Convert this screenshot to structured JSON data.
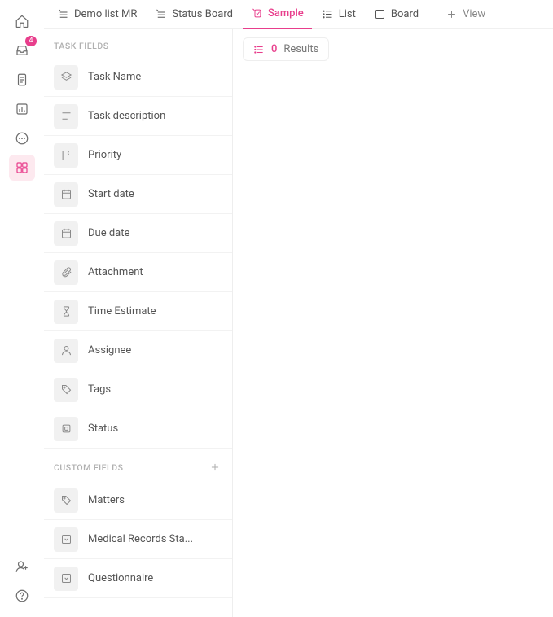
{
  "rail": {
    "inbox_badge": "4"
  },
  "tabs": [
    {
      "label": "Demo list MR",
      "icon": "list-pin"
    },
    {
      "label": "Status Board",
      "icon": "list-pin"
    },
    {
      "label": "Sample",
      "icon": "doc-pin",
      "active": true
    },
    {
      "label": "List",
      "icon": "list"
    },
    {
      "label": "Board",
      "icon": "board"
    }
  ],
  "addView": {
    "label": "View"
  },
  "sections": {
    "task_fields_header": "TASK FIELDS",
    "custom_fields_header": "CUSTOM FIELDS"
  },
  "task_fields": [
    {
      "label": "Task Name",
      "icon": "layers"
    },
    {
      "label": "Task description",
      "icon": "text"
    },
    {
      "label": "Priority",
      "icon": "flag"
    },
    {
      "label": "Start date",
      "icon": "calendar"
    },
    {
      "label": "Due date",
      "icon": "calendar"
    },
    {
      "label": "Attachment",
      "icon": "paperclip"
    },
    {
      "label": "Time Estimate",
      "icon": "hourglass"
    },
    {
      "label": "Assignee",
      "icon": "user"
    },
    {
      "label": "Tags",
      "icon": "tag"
    },
    {
      "label": "Status",
      "icon": "square"
    }
  ],
  "custom_fields": [
    {
      "label": "Matters",
      "icon": "tag"
    },
    {
      "label": "Medical Records Sta...",
      "icon": "dropdown"
    },
    {
      "label": "Questionnaire",
      "icon": "dropdown"
    }
  ],
  "results": {
    "count": "0",
    "label": "Results"
  }
}
